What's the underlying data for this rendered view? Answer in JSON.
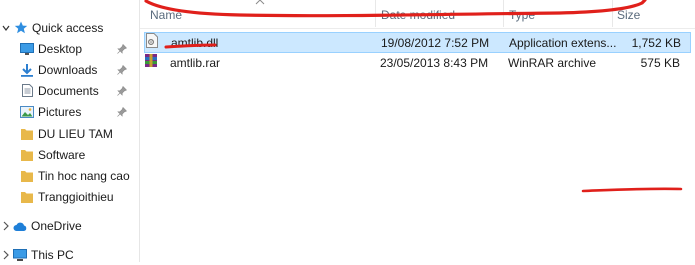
{
  "nav": {
    "items": [
      {
        "label": "Quick access",
        "icon": "star-icon"
      },
      {
        "label": "Desktop",
        "icon": "desktop-icon",
        "pinned": true
      },
      {
        "label": "Downloads",
        "icon": "download-icon",
        "pinned": true
      },
      {
        "label": "Documents",
        "icon": "documents-icon",
        "pinned": true
      },
      {
        "label": "Pictures",
        "icon": "pictures-icon",
        "pinned": true
      },
      {
        "label": "DU LIEU TAM",
        "icon": "folder-icon"
      },
      {
        "label": "Software",
        "icon": "folder-icon"
      },
      {
        "label": "Tin hoc nang cao",
        "icon": "folder-icon"
      },
      {
        "label": "Tranggioithieu",
        "icon": "folder-icon"
      },
      {
        "label": "OneDrive",
        "icon": "cloud-icon"
      },
      {
        "label": "This PC",
        "icon": "computer-icon"
      }
    ]
  },
  "columns": {
    "name": "Name",
    "date": "Date modified",
    "type": "Type",
    "size": "Size"
  },
  "files": [
    {
      "name": "amtlib.dll",
      "date": "19/08/2012 7:52 PM",
      "type": "Application extens...",
      "size": "1,752 KB",
      "selected": true,
      "icon": "dll-file-icon"
    },
    {
      "name": "amtlib.rar",
      "date": "23/05/2013 8:43 PM",
      "type": "WinRAR archive",
      "size": "575 KB",
      "selected": false,
      "icon": "winrar-archive-icon"
    }
  ],
  "colors": {
    "selection": "#cce8ff",
    "selection_border": "#99d1ff",
    "annotation": "#e0201b",
    "folder": "#e8b84a",
    "onedrive": "#1e7fd8"
  }
}
